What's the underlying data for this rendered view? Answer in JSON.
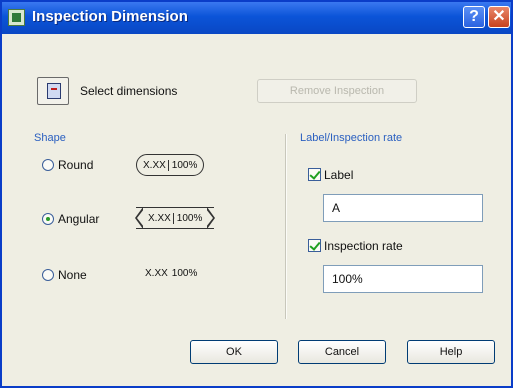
{
  "window": {
    "title": "Inspection Dimension",
    "help_button": "?",
    "close_button": "✕"
  },
  "selection": {
    "select_label": "Select dimensions",
    "remove_label": "Remove Inspection"
  },
  "shape": {
    "group_title": "Shape",
    "options": [
      {
        "label": "Round",
        "selected": false
      },
      {
        "label": "Angular",
        "selected": true
      },
      {
        "label": "None",
        "selected": false
      }
    ],
    "sample_text": "X.XX",
    "sample_rate": "100%"
  },
  "label_group": {
    "group_title": "Label/Inspection rate",
    "label_checkbox": "Label",
    "label_checked": true,
    "label_value": "A",
    "rate_checkbox": "Inspection rate",
    "rate_checked": true,
    "rate_value": "100%"
  },
  "buttons": {
    "ok": "OK",
    "cancel": "Cancel",
    "help": "Help"
  }
}
